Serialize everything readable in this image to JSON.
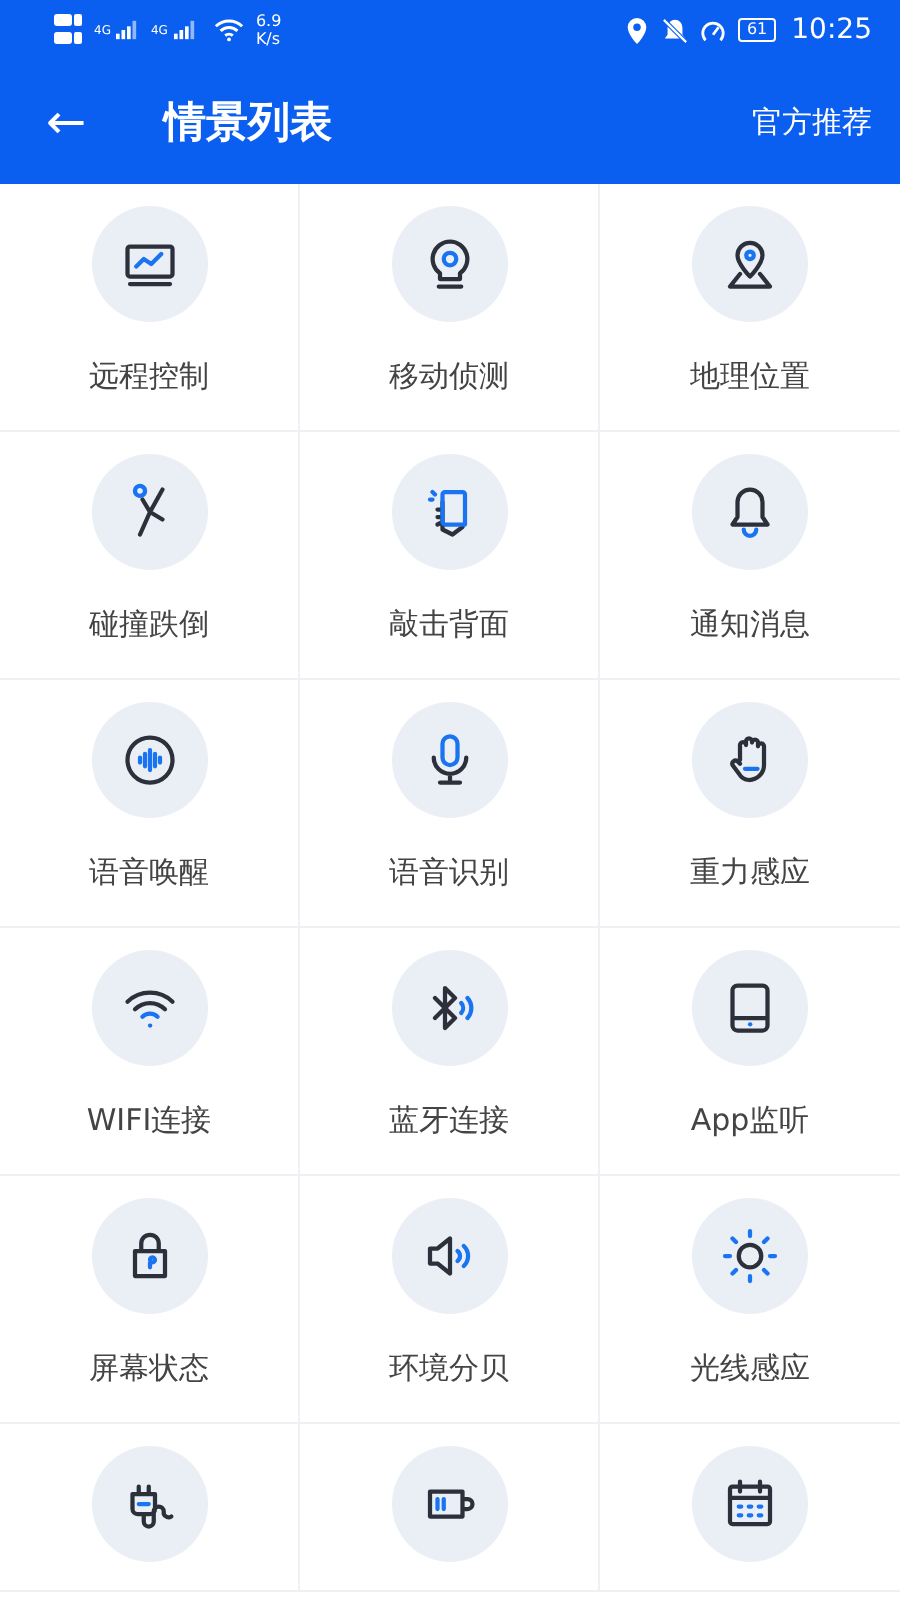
{
  "status_bar": {
    "signal_labels": [
      "4G",
      "4G"
    ],
    "network_speed": "6.9",
    "speed_unit": "K/s",
    "battery": "61",
    "time": "10:25"
  },
  "app_bar": {
    "back": "←",
    "title": "情景列表",
    "action": "官方推荐"
  },
  "scenes": [
    {
      "kind": "full",
      "label": "远程控制"
    },
    {
      "kind": "full",
      "label": "移动侦测"
    },
    {
      "kind": "full",
      "label": "地理位置"
    },
    {
      "kind": "full",
      "label": "碰撞跌倒"
    },
    {
      "kind": "full",
      "label": "敲击背面"
    },
    {
      "kind": "full",
      "label": "通知消息"
    },
    {
      "kind": "full",
      "label": "语音唤醒"
    },
    {
      "kind": "full",
      "label": "语音识别"
    },
    {
      "kind": "full",
      "label": "重力感应"
    },
    {
      "kind": "full",
      "label": "WIFI连接"
    },
    {
      "kind": "full",
      "label": "蓝牙连接"
    },
    {
      "kind": "full",
      "label": "App监听"
    },
    {
      "kind": "full",
      "label": "屏幕状态"
    },
    {
      "kind": "full",
      "label": "环境分贝"
    },
    {
      "kind": "full",
      "label": "光线感应"
    },
    {
      "kind": "cut_off"
    },
    {
      "kind": "cut_off"
    },
    {
      "kind": "cut_off"
    }
  ]
}
